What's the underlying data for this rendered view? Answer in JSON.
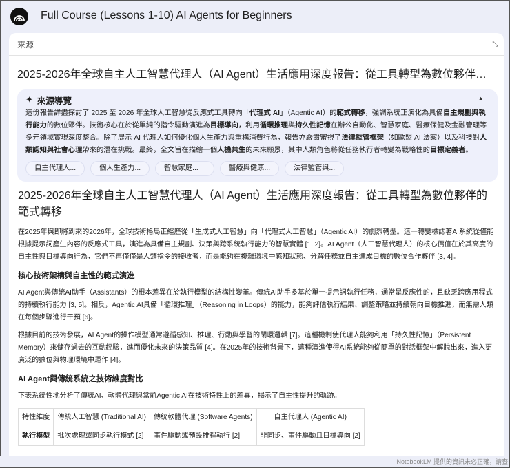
{
  "app": {
    "title": "Full Course (Lessons 1-10) AI Agents for Beginners"
  },
  "sources": {
    "label": "來源"
  },
  "doc": {
    "title": "2025-2026年全球自主人工智慧代理人（AI Agent）生活應用深度報告：從工具轉型為數位夥伴的範式轉移"
  },
  "guide": {
    "title": "來源導覽",
    "segments": [
      {
        "t": "這份報告詳盡探討了 2025 至 2026 年全球人工智慧從反應式工具轉向「"
      },
      {
        "t": "代理式 AI",
        "b": true
      },
      {
        "t": "」（Agentic AI）的"
      },
      {
        "t": "範式轉移",
        "b": true
      },
      {
        "t": "，強調系統正演化為具備"
      },
      {
        "t": "自主規劃與執行能力",
        "b": true
      },
      {
        "t": "的數位夥伴。技術核心在於從單純的指令驅動演進為"
      },
      {
        "t": "目標導向",
        "b": true
      },
      {
        "t": "，利用"
      },
      {
        "t": "循環推理",
        "b": true
      },
      {
        "t": "與"
      },
      {
        "t": "持久性記憶",
        "b": true
      },
      {
        "t": "在辦公自動化、智慧家庭、醫療保健及金融管理等多元領域實現深度整合。除了展示 AI 代理人如何優化個人生產力與重構消費行為，報告亦嚴肅審視了"
      },
      {
        "t": "法律監管框架",
        "b": true
      },
      {
        "t": "（如歐盟 AI 法案）以及科技對"
      },
      {
        "t": "人類認知與社會心理",
        "b": true
      },
      {
        "t": "帶來的潛在挑戰。最終，全文旨在描繪一個"
      },
      {
        "t": "人機共生",
        "b": true
      },
      {
        "t": "的未來願景，其中人類角色將從任務執行者轉變為戰略性的"
      },
      {
        "t": "目標定義者",
        "b": true
      },
      {
        "t": "。"
      }
    ],
    "chips": [
      "自主代理人...",
      "個人生產力...",
      "智慧家庭...",
      "醫療與健康...",
      "法律監管與..."
    ]
  },
  "article": {
    "heading": "2025-2026年全球自主人工智慧代理人（AI Agent）生活應用深度報告：從工具轉型為數位夥伴的範式轉移",
    "p1": "在2025年與即將到來的2026年，全球技術格局正經歷從「生成式人工智慧」向「代理式人工智慧」（Agentic AI）的劇烈轉型。這一轉變標誌著AI系統從僅能根據提示詞產生內容的反應式工具，演進為具備自主規劃、決策與跨系統執行能力的智慧實體 [1, 2]。AI Agent（人工智慧代理人）的核心價值在於其高度的自主性與目標導向行為，它們不再僅僅是人類指令的接收者，而是能夠在複雜環境中感知狀態、分解任務並自主達成目標的數位合作夥伴 [3, 4]。",
    "h2": "核心技術架構與自主性的範式演進",
    "p2": "AI Agent與傳統AI助手（Assistants）的根本差異在於執行模型的結構性變革。傳統AI助手多基於單一提示詞執行任務，通常是反應性的，且缺乏跨應用程式的持續執行能力 [3, 5]。相反，Agentic AI具備「循環推理」（Reasoning in Loops）的能力，能夠評估執行結果、調整策略並持續朝向目標推進，而無需人類在每個步驟進行干預 [6]。",
    "p3": "根據目前的技術發展，AI Agent的操作模型通常遵循感知、推理、行動與學習的閉環邏輯 [7]。這種機制使代理人能夠利用「持久性記憶」（Persistent Memory）來儲存過去的互動經驗，進而優化未來的決策品質 [4]。在2025年的技術背景下，這種演進使得AI系統能夠從簡單的對話框架中解脫出來，進入更廣泛的數位與物理環境中運作 [4]。",
    "h3": "AI Agent與傳統系統之技術維度對比",
    "p4": "下表系統性地分析了傳統AI、軟體代理與當前Agentic AI在技術特性上的差異，揭示了自主性提升的軌跡。",
    "table": {
      "headers": [
        "特性維度",
        "傳統人工智慧 (Traditional AI)",
        "傳統軟體代理 (Software Agents)",
        "自主代理人 (Agentic AI)"
      ],
      "rows": [
        [
          "執行模型",
          "批次處理或同步執行模式 [2]",
          "事件驅動或預設排程執行 [2]",
          "非同步、事件驅動且目標導向 [2]"
        ]
      ]
    }
  },
  "footer": {
    "disclaimer": "NotebookLM 提供的資訊未必正確，請查"
  }
}
